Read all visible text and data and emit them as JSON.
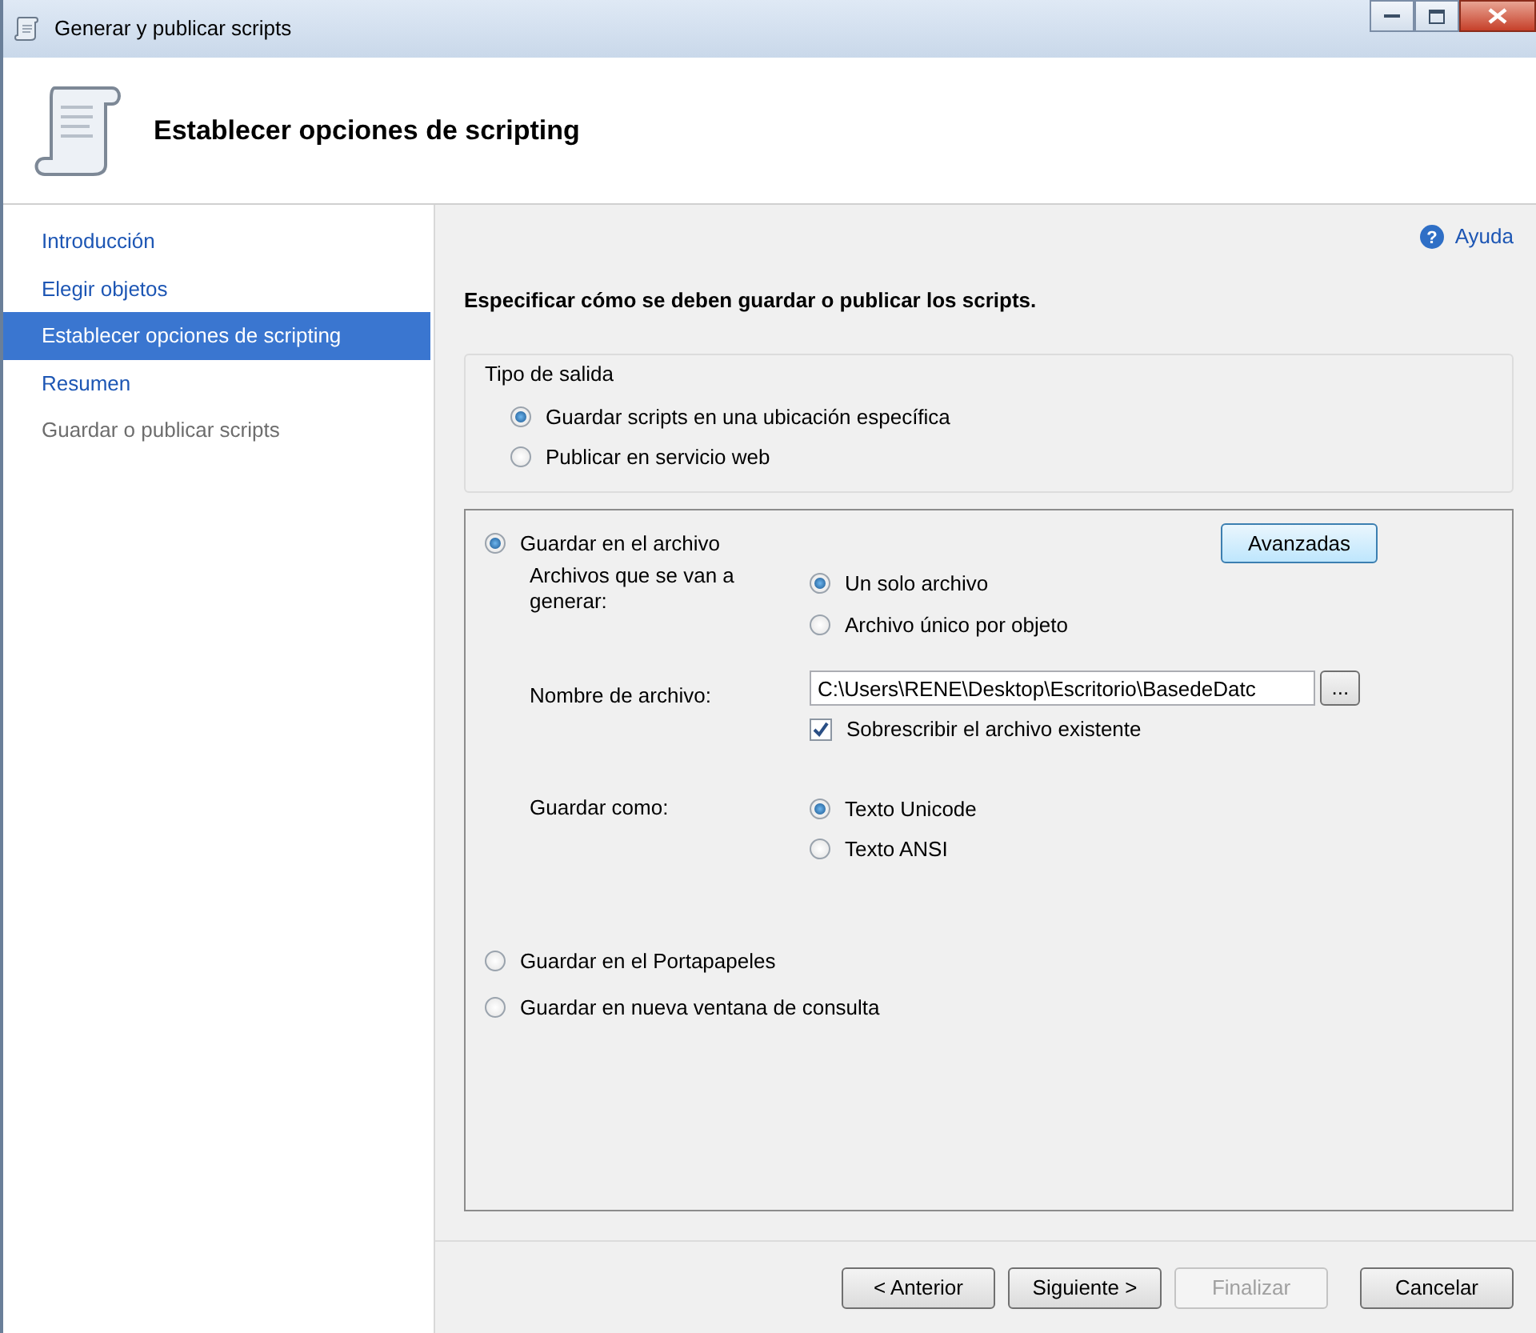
{
  "window": {
    "title": "Generar y publicar scripts"
  },
  "header": {
    "title": "Establecer opciones de scripting"
  },
  "sidebar": {
    "items": [
      {
        "label": "Introducción",
        "selected": false,
        "disabled": false
      },
      {
        "label": "Elegir objetos",
        "selected": false,
        "disabled": false
      },
      {
        "label": "Establecer opciones de scripting",
        "selected": true,
        "disabled": false
      },
      {
        "label": "Resumen",
        "selected": false,
        "disabled": false
      },
      {
        "label": "Guardar o publicar scripts",
        "selected": false,
        "disabled": true
      }
    ]
  },
  "help_icon": "?",
  "help_link": "Ayuda",
  "instruction": "Especificar cómo se deben guardar o publicar los scripts.",
  "output_type": {
    "legend": "Tipo de salida",
    "options": [
      {
        "label": "Guardar scripts en una ubicación específica",
        "selected": true
      },
      {
        "label": "Publicar en servicio web",
        "selected": false
      }
    ]
  },
  "save_to_file": {
    "label": "Guardar en el archivo",
    "selected": true
  },
  "advanced_button": "Avanzadas",
  "files_label": "Archivos que se van a generar:",
  "file_options": [
    {
      "label": "Un solo archivo",
      "selected": true
    },
    {
      "label": "Archivo único por objeto",
      "selected": false
    }
  ],
  "filename_label": "Nombre de archivo:",
  "filename_value": "C:\\Users\\RENE\\Desktop\\Escritorio\\BasedeDatc",
  "browse_button": "...",
  "overwrite": {
    "label": "Sobrescribir el archivo existente",
    "checked": true
  },
  "save_as_label": "Guardar como:",
  "encoding_options": [
    {
      "label": "Texto Unicode",
      "selected": true
    },
    {
      "label": "Texto ANSI",
      "selected": false
    }
  ],
  "other_destinations": [
    {
      "label": "Guardar en el Portapapeles",
      "selected": false
    },
    {
      "label": "Guardar en nueva ventana de consulta",
      "selected": false
    }
  ],
  "buttons": [
    {
      "label": "< Anterior",
      "disabled": false
    },
    {
      "label": "Siguiente >",
      "disabled": false
    },
    {
      "label": "Finalizar",
      "disabled": true
    },
    {
      "label": "Cancelar",
      "disabled": false
    }
  ]
}
